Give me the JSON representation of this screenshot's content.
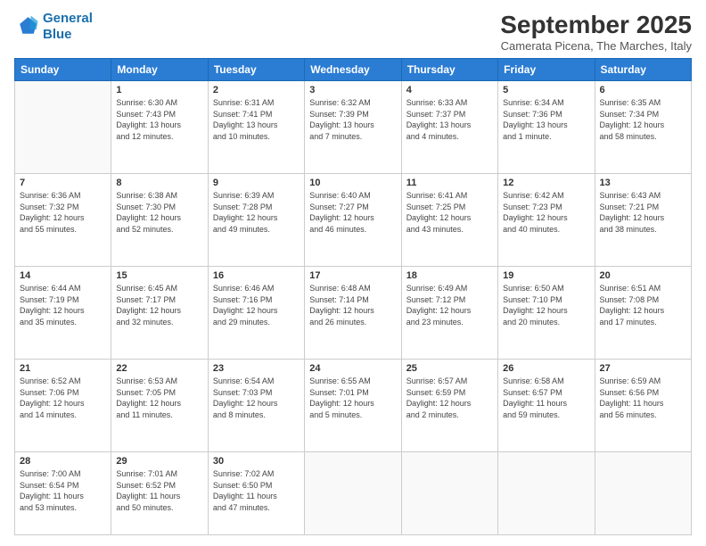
{
  "logo": {
    "line1": "General",
    "line2": "Blue"
  },
  "title": "September 2025",
  "location": "Camerata Picena, The Marches, Italy",
  "weekdays": [
    "Sunday",
    "Monday",
    "Tuesday",
    "Wednesday",
    "Thursday",
    "Friday",
    "Saturday"
  ],
  "weeks": [
    [
      {
        "day": "",
        "info": ""
      },
      {
        "day": "1",
        "info": "Sunrise: 6:30 AM\nSunset: 7:43 PM\nDaylight: 13 hours\nand 12 minutes."
      },
      {
        "day": "2",
        "info": "Sunrise: 6:31 AM\nSunset: 7:41 PM\nDaylight: 13 hours\nand 10 minutes."
      },
      {
        "day": "3",
        "info": "Sunrise: 6:32 AM\nSunset: 7:39 PM\nDaylight: 13 hours\nand 7 minutes."
      },
      {
        "day": "4",
        "info": "Sunrise: 6:33 AM\nSunset: 7:37 PM\nDaylight: 13 hours\nand 4 minutes."
      },
      {
        "day": "5",
        "info": "Sunrise: 6:34 AM\nSunset: 7:36 PM\nDaylight: 13 hours\nand 1 minute."
      },
      {
        "day": "6",
        "info": "Sunrise: 6:35 AM\nSunset: 7:34 PM\nDaylight: 12 hours\nand 58 minutes."
      }
    ],
    [
      {
        "day": "7",
        "info": "Sunrise: 6:36 AM\nSunset: 7:32 PM\nDaylight: 12 hours\nand 55 minutes."
      },
      {
        "day": "8",
        "info": "Sunrise: 6:38 AM\nSunset: 7:30 PM\nDaylight: 12 hours\nand 52 minutes."
      },
      {
        "day": "9",
        "info": "Sunrise: 6:39 AM\nSunset: 7:28 PM\nDaylight: 12 hours\nand 49 minutes."
      },
      {
        "day": "10",
        "info": "Sunrise: 6:40 AM\nSunset: 7:27 PM\nDaylight: 12 hours\nand 46 minutes."
      },
      {
        "day": "11",
        "info": "Sunrise: 6:41 AM\nSunset: 7:25 PM\nDaylight: 12 hours\nand 43 minutes."
      },
      {
        "day": "12",
        "info": "Sunrise: 6:42 AM\nSunset: 7:23 PM\nDaylight: 12 hours\nand 40 minutes."
      },
      {
        "day": "13",
        "info": "Sunrise: 6:43 AM\nSunset: 7:21 PM\nDaylight: 12 hours\nand 38 minutes."
      }
    ],
    [
      {
        "day": "14",
        "info": "Sunrise: 6:44 AM\nSunset: 7:19 PM\nDaylight: 12 hours\nand 35 minutes."
      },
      {
        "day": "15",
        "info": "Sunrise: 6:45 AM\nSunset: 7:17 PM\nDaylight: 12 hours\nand 32 minutes."
      },
      {
        "day": "16",
        "info": "Sunrise: 6:46 AM\nSunset: 7:16 PM\nDaylight: 12 hours\nand 29 minutes."
      },
      {
        "day": "17",
        "info": "Sunrise: 6:48 AM\nSunset: 7:14 PM\nDaylight: 12 hours\nand 26 minutes."
      },
      {
        "day": "18",
        "info": "Sunrise: 6:49 AM\nSunset: 7:12 PM\nDaylight: 12 hours\nand 23 minutes."
      },
      {
        "day": "19",
        "info": "Sunrise: 6:50 AM\nSunset: 7:10 PM\nDaylight: 12 hours\nand 20 minutes."
      },
      {
        "day": "20",
        "info": "Sunrise: 6:51 AM\nSunset: 7:08 PM\nDaylight: 12 hours\nand 17 minutes."
      }
    ],
    [
      {
        "day": "21",
        "info": "Sunrise: 6:52 AM\nSunset: 7:06 PM\nDaylight: 12 hours\nand 14 minutes."
      },
      {
        "day": "22",
        "info": "Sunrise: 6:53 AM\nSunset: 7:05 PM\nDaylight: 12 hours\nand 11 minutes."
      },
      {
        "day": "23",
        "info": "Sunrise: 6:54 AM\nSunset: 7:03 PM\nDaylight: 12 hours\nand 8 minutes."
      },
      {
        "day": "24",
        "info": "Sunrise: 6:55 AM\nSunset: 7:01 PM\nDaylight: 12 hours\nand 5 minutes."
      },
      {
        "day": "25",
        "info": "Sunrise: 6:57 AM\nSunset: 6:59 PM\nDaylight: 12 hours\nand 2 minutes."
      },
      {
        "day": "26",
        "info": "Sunrise: 6:58 AM\nSunset: 6:57 PM\nDaylight: 11 hours\nand 59 minutes."
      },
      {
        "day": "27",
        "info": "Sunrise: 6:59 AM\nSunset: 6:56 PM\nDaylight: 11 hours\nand 56 minutes."
      }
    ],
    [
      {
        "day": "28",
        "info": "Sunrise: 7:00 AM\nSunset: 6:54 PM\nDaylight: 11 hours\nand 53 minutes."
      },
      {
        "day": "29",
        "info": "Sunrise: 7:01 AM\nSunset: 6:52 PM\nDaylight: 11 hours\nand 50 minutes."
      },
      {
        "day": "30",
        "info": "Sunrise: 7:02 AM\nSunset: 6:50 PM\nDaylight: 11 hours\nand 47 minutes."
      },
      {
        "day": "",
        "info": ""
      },
      {
        "day": "",
        "info": ""
      },
      {
        "day": "",
        "info": ""
      },
      {
        "day": "",
        "info": ""
      }
    ]
  ]
}
